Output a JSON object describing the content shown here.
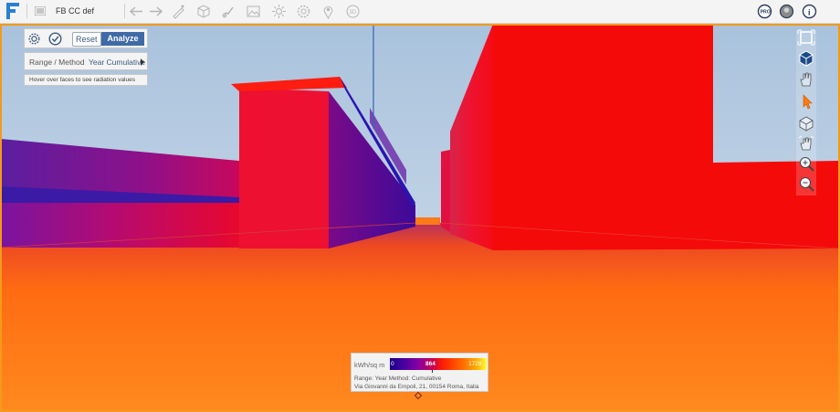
{
  "app": {
    "project_title": "FB  CC def",
    "toolbar_icons": [
      "back-arrow-icon",
      "forward-arrow-icon",
      "draw-icon",
      "box-icon",
      "paint-icon",
      "image-icon",
      "sun-icon",
      "settings-icon",
      "location-pin-icon",
      "3d-icon"
    ],
    "right_icons": [
      "pro-badge-icon",
      "user-avatar-icon",
      "info-icon"
    ],
    "pro_label": "PRO",
    "info_label": "i"
  },
  "panel": {
    "reset_label": "Reset",
    "analyze_label": "Analyze",
    "range_method_label": "Range / Method",
    "range_method_value": "Year Cumulative",
    "hint_text": "Hover over faces to see radiation values"
  },
  "view_tools": [
    "frame-icon",
    "cube-icon",
    "pan-hand-icon",
    "pointer-icon",
    "orbit-icon",
    "grab-hand-icon",
    "zoom-in-icon",
    "zoom-out-icon"
  ],
  "legend": {
    "unit": "kWh/sq m",
    "min": "0",
    "mid": "864",
    "max": "1729",
    "range_text": "Range: Year   Method: Cumulative",
    "address": "Via Giovanni da Empoli, 21, 00154 Roma, Italia"
  },
  "colors": {
    "accent_border": "#f39a1a",
    "analyze_button": "#3f6aa6",
    "radiation_high": "#ff1a00",
    "radiation_low": "#3a0090"
  }
}
